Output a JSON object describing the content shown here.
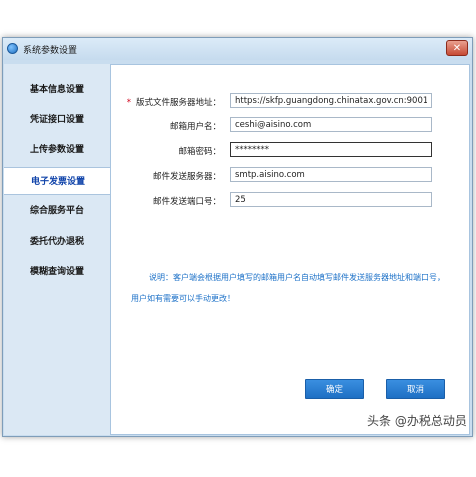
{
  "window": {
    "title": "系统参数设置",
    "close_glyph": "✕"
  },
  "sidebar": {
    "items": [
      {
        "label": "基本信息设置"
      },
      {
        "label": "凭证接口设置"
      },
      {
        "label": "上传参数设置"
      },
      {
        "label": "电子发票设置"
      },
      {
        "label": "综合服务平台"
      },
      {
        "label": "委托代办退税"
      },
      {
        "label": "模糊查询设置"
      }
    ],
    "active_index": 3
  },
  "form": {
    "required_mark": "*",
    "fields": [
      {
        "label": "版式文件服务器地址：",
        "value": "https://skfp.guangdong.chinatax.gov.cn:9001",
        "required": true
      },
      {
        "label": "邮箱用户名：",
        "value": "ceshi@aisino.com"
      },
      {
        "label": "邮箱密码：",
        "value": "********"
      },
      {
        "label": "邮件发送服务器：",
        "value": "smtp.aisino.com"
      },
      {
        "label": "邮件发送端口号：",
        "value": "25"
      }
    ]
  },
  "notes": {
    "line1": "说明：客户端会根据用户填写的邮箱用户名自动填写邮件发送服务器地址和端口号，",
    "line2": "用户如有需要可以手动更改！"
  },
  "buttons": {
    "ok": "确定",
    "cancel": "取消"
  },
  "watermark": "头条 @办税总动员",
  "colors": {
    "accent": "#1e72c8",
    "button": "#2a7fd6",
    "active_nav_text": "#1144aa"
  }
}
